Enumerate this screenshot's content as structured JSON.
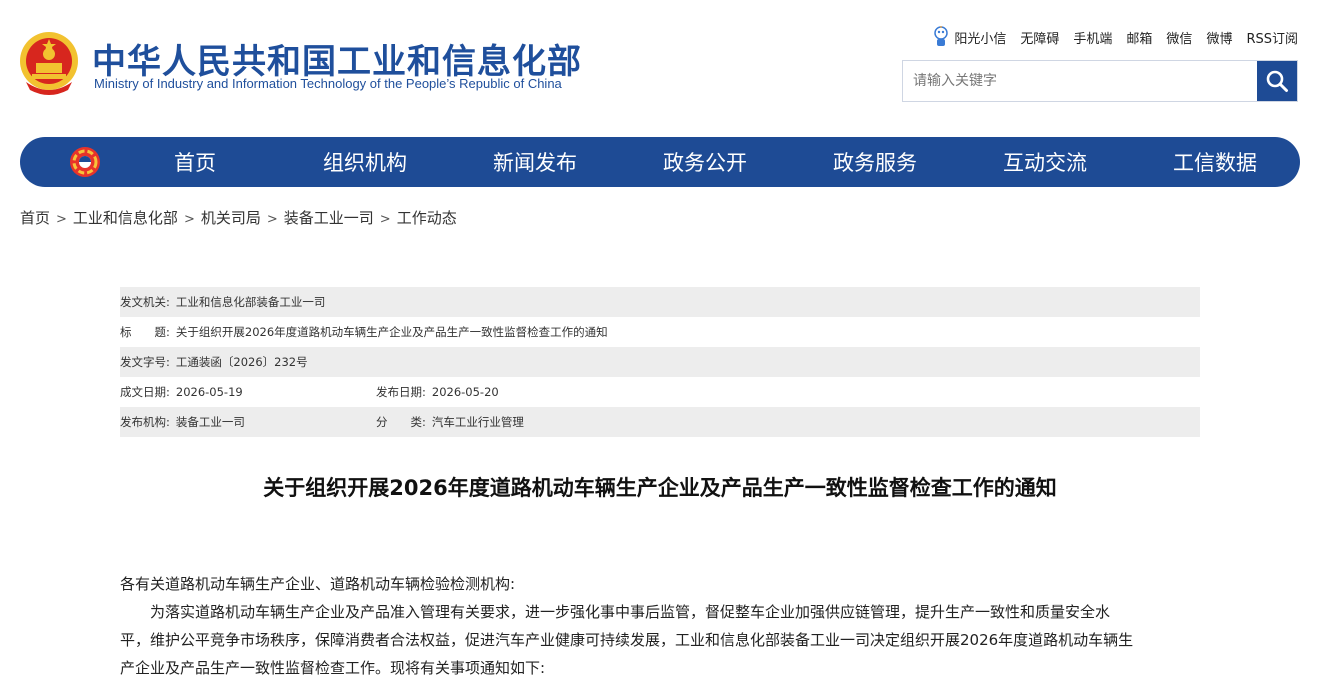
{
  "header": {
    "title": "中华人民共和国工业和信息化部",
    "subtitle": "Ministry of Industry and Information Technology of the People’s Republic of China",
    "toplinks": [
      "阳光小信",
      "无障碍",
      "手机端",
      "邮箱",
      "微信",
      "微博",
      "RSS订阅"
    ]
  },
  "search": {
    "placeholder": "请输入关键字"
  },
  "nav": {
    "items": [
      "首页",
      "组织机构",
      "新闻发布",
      "政务公开",
      "政务服务",
      "互动交流",
      "工信数据"
    ]
  },
  "breadcrumb": [
    "首页",
    "工业和信息化部",
    "机关司局",
    "装备工业一司",
    "工作动态"
  ],
  "meta": {
    "issuer_label": "发文机关:",
    "issuer": "工业和信息化部装备工业一司",
    "title_label": "标　　题:",
    "title": "关于组织开展2026年度道路机动车辆生产企业及产品生产一致性监督检查工作的通知",
    "docno_label": "发文字号:",
    "docno": "工通装函〔2026〕232号",
    "created_label": "成文日期:",
    "created": "2026-05-19",
    "published_label": "发布日期:",
    "published": "2026-05-20",
    "org_label": "发布机构:",
    "org": "装备工业一司",
    "category_label": "分　　类:",
    "category": "汽车工业行业管理"
  },
  "document": {
    "title": "关于组织开展2026年度道路机动车辆生产企业及产品生产一致性监督检查工作的通知",
    "salutation": "各有关道路机动车辆生产企业、道路机动车辆检验检测机构:",
    "para1_line1": "为落实道路机动车辆生产企业及产品准入管理有关要求，进一步强化事中事后监管，督促整车企业加强供应链管理，提升生产一致性和质量安全水",
    "para1_line2": "平，维护公平竞争市场秩序，保障消费者合法权益，促进汽车产业健康可持续发展，工业和信息化部装备工业一司决定组织开展2026年度道路机动车辆生",
    "para1_line3": "产企业及产品生产一致性监督检查工作。现将有关事项通知如下:"
  }
}
